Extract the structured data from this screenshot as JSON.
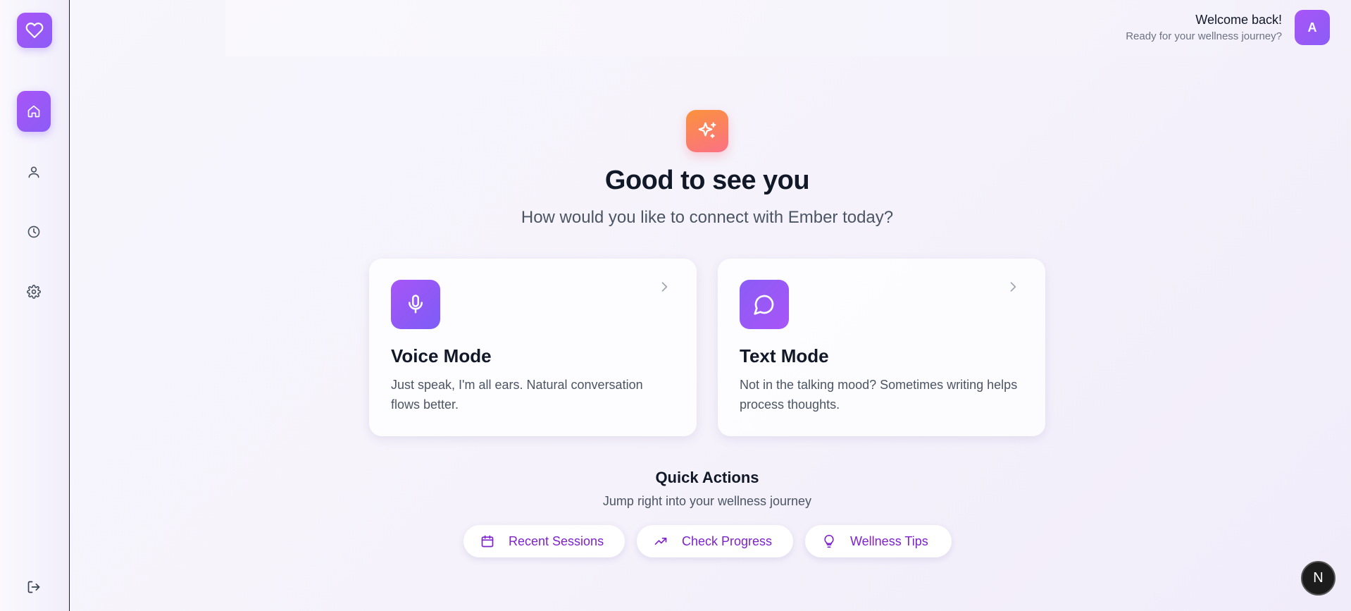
{
  "sidebar": {
    "logo_icon": "heart-icon",
    "items": [
      {
        "name": "home",
        "icon": "home-icon",
        "active": true
      },
      {
        "name": "profile",
        "icon": "user-icon",
        "active": false
      },
      {
        "name": "history",
        "icon": "clock-icon",
        "active": false
      },
      {
        "name": "settings",
        "icon": "gear-icon",
        "active": false
      }
    ],
    "logout_icon": "logout-icon"
  },
  "header": {
    "welcome_title": "Welcome back!",
    "welcome_subtitle": "Ready for your wellness journey?",
    "avatar_initial": "A"
  },
  "hero": {
    "icon": "sparkle-icon",
    "title": "Good to see you",
    "subtitle": "How would you like to connect with Ember today?"
  },
  "modes": [
    {
      "icon": "microphone-icon",
      "title": "Voice Mode",
      "description": "Just speak, I'm all ears. Natural conversation flows better."
    },
    {
      "icon": "chat-bubble-icon",
      "title": "Text Mode",
      "description": "Not in the talking mood? Sometimes writing helps process thoughts."
    }
  ],
  "quick_actions": {
    "title": "Quick Actions",
    "subtitle": "Jump right into your wellness journey",
    "items": [
      {
        "label": "Recent Sessions",
        "icon": "calendar-icon"
      },
      {
        "label": "Check Progress",
        "icon": "trending-up-icon"
      },
      {
        "label": "Wellness Tips",
        "icon": "lightbulb-icon"
      }
    ]
  },
  "floating_button": {
    "label": "N"
  },
  "colors": {
    "accent_purple": "#8b5cf6",
    "accent_violet": "#a855f7",
    "sparkle_orange": "#fb923c",
    "sparkle_pink": "#fb7185",
    "action_text": "#7e22ce"
  }
}
